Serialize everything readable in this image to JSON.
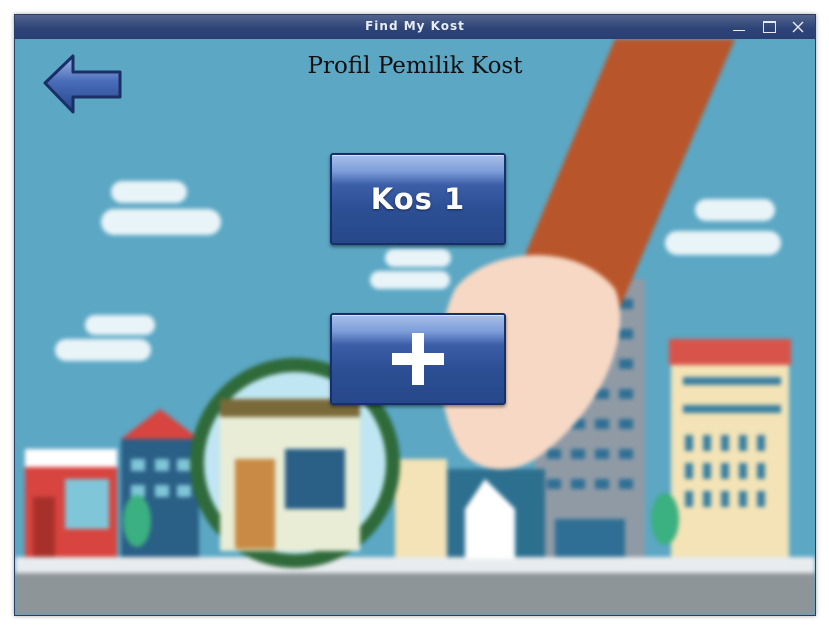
{
  "window": {
    "title": "Find My Kost",
    "controls": {
      "minimize": "minimize-icon",
      "maximize": "maximize-icon",
      "close": "close-icon"
    }
  },
  "page": {
    "title": "Profil Pemilik Kost",
    "back_button": "back-arrow-icon"
  },
  "buttons": {
    "kos1_label": "Kos 1",
    "add_icon": "plus-icon"
  },
  "colors": {
    "titlebar": "#2e4478",
    "button_fill": "#2c4f95",
    "button_border": "#17306b",
    "sky": "#5aa6c4"
  }
}
